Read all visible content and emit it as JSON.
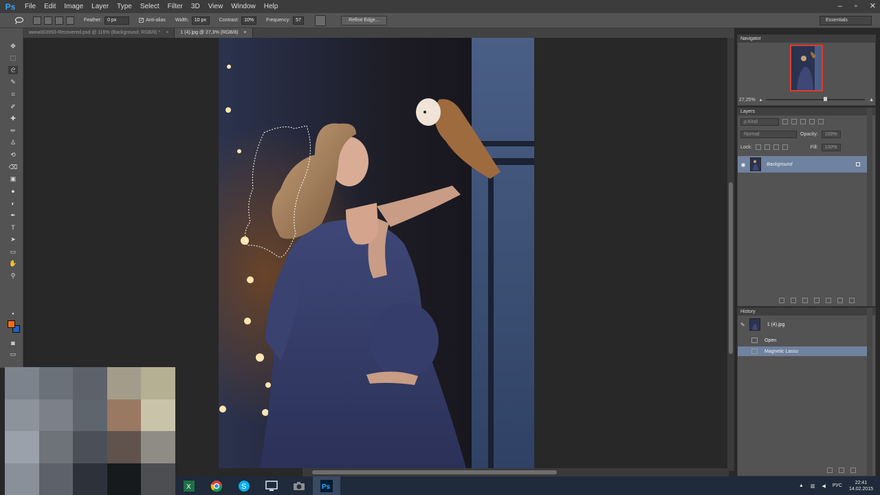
{
  "app": {
    "logo": "Ps"
  },
  "menu": [
    "File",
    "Edit",
    "Image",
    "Layer",
    "Type",
    "Select",
    "Filter",
    "3D",
    "View",
    "Window",
    "Help"
  ],
  "window_controls": [
    "–",
    "▫",
    "✕"
  ],
  "options": {
    "feather_label": "Feather:",
    "feather_value": "0 px",
    "antialias_label": "Anti-alias",
    "width_label": "Width:",
    "width_value": "10 px",
    "contrast_label": "Contrast:",
    "contrast_value": "10%",
    "frequency_label": "Frequency:",
    "frequency_value": "57",
    "refine_label": "Refine Edge...",
    "workspace_value": "Essentials"
  },
  "tabs": [
    {
      "label": "мини003993-Recovered.psd @ 116% (Background, RGB/8) *",
      "close": "×"
    },
    {
      "label": "1 (4).jpg @ 27,3% (RGB/8)",
      "close": "×"
    }
  ],
  "tool_icons": [
    "move-icon",
    "marquee-icon",
    "lasso-icon",
    "quick-select-icon",
    "crop-icon",
    "eyedropper-icon",
    "healing-icon",
    "brush-icon",
    "clone-stamp-icon",
    "history-brush-icon",
    "eraser-icon",
    "gradient-icon",
    "blur-icon",
    "dodge-icon",
    "pen-icon",
    "type-icon",
    "path-select-icon",
    "rectangle-icon",
    "hand-icon",
    "zoom-icon"
  ],
  "colors": {
    "foreground": "#f26a1b",
    "background": "#1c5fbd",
    "selection": "#6f829f"
  },
  "navigator": {
    "title": "Navigator",
    "zoom": "27,25%"
  },
  "layers": {
    "title": "Layers",
    "kind": "ρ Kind",
    "blend": "Normal",
    "opacity_label": "Opacity:",
    "opacity_value": "100%",
    "lock_label": "Lock:",
    "fill_label": "Fill:",
    "fill_value": "100%",
    "items": [
      {
        "name": "Background",
        "visible": true,
        "locked": true
      }
    ]
  },
  "history": {
    "title": "History",
    "snapshot": "1 (4).jpg",
    "steps": [
      {
        "label": "Open",
        "selected": false
      },
      {
        "label": "Magnetic Lasso",
        "selected": true
      }
    ]
  },
  "taskbar": {
    "apps": [
      "excel-icon",
      "chrome-icon",
      "skype-icon",
      "monitor-icon",
      "camera-icon",
      "photoshop-icon"
    ],
    "lang": "РУС",
    "time": "22:41",
    "date": "14.02.2015"
  },
  "mosaic": [
    "#7d838c",
    "#6b7179",
    "#5d6169",
    "#a39c8b",
    "#b5b093",
    "#8d939b",
    "#7b8089",
    "#5f656d",
    "#9a7963",
    "#c9c3aa",
    "#9aa1aa",
    "#6e737a",
    "#4a4f58",
    "#60534d",
    "#8f8c86",
    "#8a9099",
    "#5d626a",
    "#2d3139",
    "#171a1c",
    "#4c4e52"
  ]
}
